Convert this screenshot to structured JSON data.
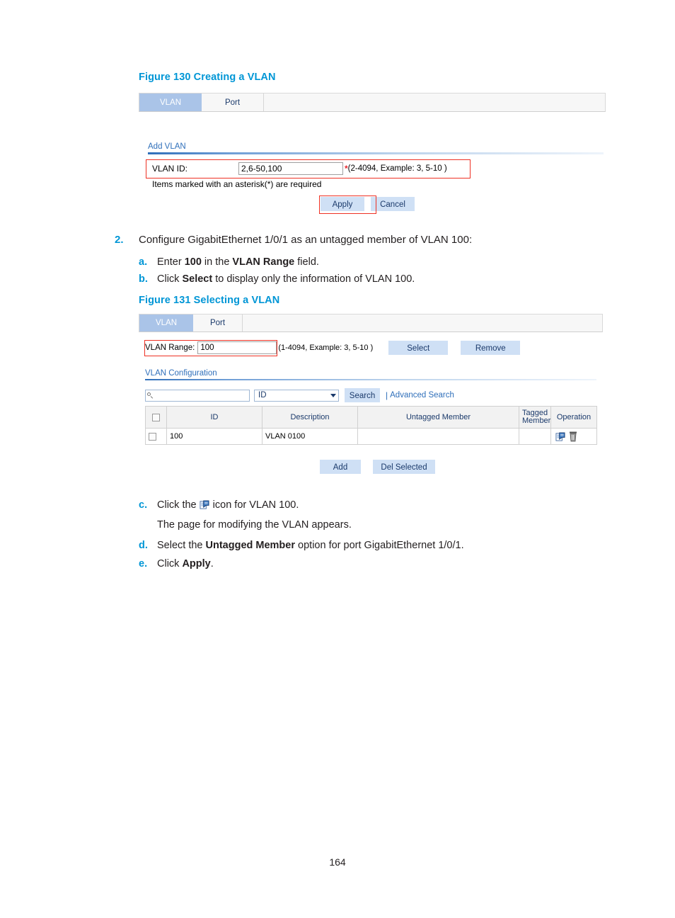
{
  "page": {
    "folio": "164"
  },
  "figure130": {
    "title": "Figure 130 Creating a VLAN",
    "tabs": [
      {
        "label": "VLAN",
        "active": true
      },
      {
        "label": "Port",
        "active": false
      }
    ],
    "section_label": "Add VLAN",
    "form": {
      "vlan_id_label": "VLAN ID:",
      "vlan_id_value": "2,6-50,100",
      "asterisk": "*",
      "hint": "(2-4094, Example: 3, 5-10 )"
    },
    "required_note": "Items marked with an asterisk(*) are required",
    "buttons": {
      "apply": "Apply",
      "cancel": "Cancel"
    }
  },
  "step2": {
    "number": "2.",
    "text": "Configure GigabitEthernet 1/0/1 as an untagged member of VLAN 100:",
    "sub_a": {
      "letter": "a.",
      "pre": "Enter ",
      "bold1": "100",
      "mid": " in the ",
      "bold2": "VLAN Range",
      "post": " field."
    },
    "sub_b": {
      "letter": "b.",
      "pre": "Click ",
      "bold1": "Select",
      "post": " to display only the information of VLAN 100."
    },
    "sub_c": {
      "letter": "c.",
      "pre": "Click the ",
      "icon": "modify-vlan-icon",
      "post": " icon for VLAN 100.",
      "line2": "The page for modifying the VLAN appears."
    },
    "sub_d": {
      "letter": "d.",
      "pre": "Select the ",
      "bold1": "Untagged Member",
      "post": " option for port GigabitEthernet 1/0/1."
    },
    "sub_e": {
      "letter": "e.",
      "pre": "Click ",
      "bold1": "Apply",
      "post": "."
    }
  },
  "figure131": {
    "title": "Figure 131 Selecting a VLAN",
    "tabs": [
      {
        "label": "VLAN",
        "active": true
      },
      {
        "label": "Port",
        "active": false
      }
    ],
    "range_row": {
      "label": "VLAN Range:",
      "value": "100",
      "hint": "(1-4094, Example: 3, 5-10 )",
      "select_button": "Select",
      "remove_button": "Remove"
    },
    "section_label": "VLAN Configuration",
    "search": {
      "input_value": "",
      "input_placeholder": "",
      "field_selected": "ID",
      "search_button": "Search",
      "advanced_search": "Advanced Search",
      "separator": "|"
    },
    "table": {
      "columns": [
        "",
        "ID",
        "Description",
        "Untagged Member",
        "Tagged Member",
        "Operation"
      ],
      "rows": [
        {
          "id": "100",
          "description": "VLAN 0100",
          "untagged_member": "",
          "tagged_member": "",
          "operation_icons": [
            "modify-icon",
            "delete-icon"
          ]
        }
      ]
    },
    "footer_buttons": {
      "add": "Add",
      "del_selected": "Del Selected"
    }
  },
  "colors": {
    "figure_title": "#0096d6",
    "tab_active_bg": "#aac4e8",
    "ui_text": "#1b3a6b",
    "annotation_red": "#ee3124",
    "button_bg": "#cfe0f5",
    "link": "#2f6fba"
  }
}
